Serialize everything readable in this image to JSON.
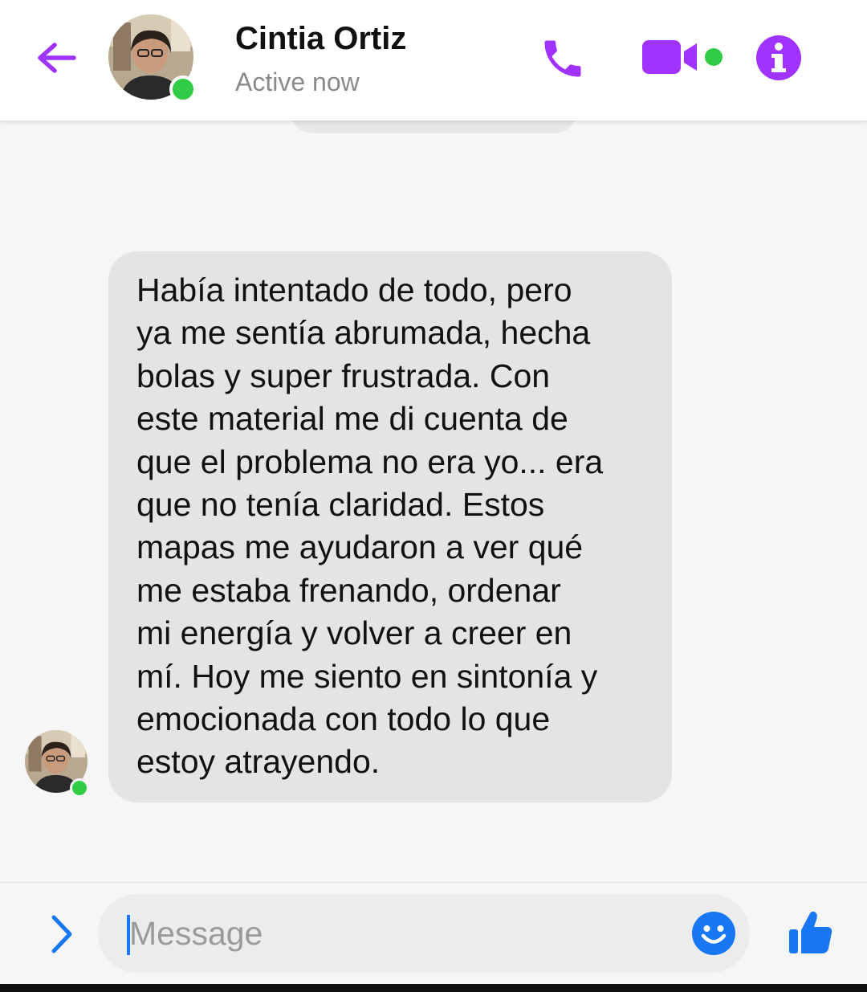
{
  "colors": {
    "accent": "#a033ff",
    "presence": "#31cc46",
    "messenger_blue": "#1877f2",
    "bubble": "#e4e4e4"
  },
  "header": {
    "back_icon": "arrow-left-icon",
    "contact_name": "Cintia Ortiz",
    "status": "Active now",
    "call_icon": "phone-icon",
    "video_icon": "video-camera-icon",
    "info_icon": "info-icon"
  },
  "conversation": {
    "message": {
      "lines": [
        "Había intentado de todo, pero",
        "ya me sentía abrumada, hecha",
        "bolas y super frustrada. Con",
        "este material me di cuenta de",
        "que el problema no era yo... era",
        "que no tenía claridad. Estos",
        "mapas me ayudaron a ver qué",
        "me estaba frenando, ordenar",
        "mi energía y volver a creer en",
        "mí. Hoy me siento en sintonía y",
        "emocionada con todo lo que",
        "estoy atrayendo."
      ]
    }
  },
  "composer": {
    "expand_icon": "chevron-right-icon",
    "placeholder": "Message",
    "value": "",
    "emoji_icon": "smiley-icon",
    "like_icon": "thumbs-up-icon"
  }
}
